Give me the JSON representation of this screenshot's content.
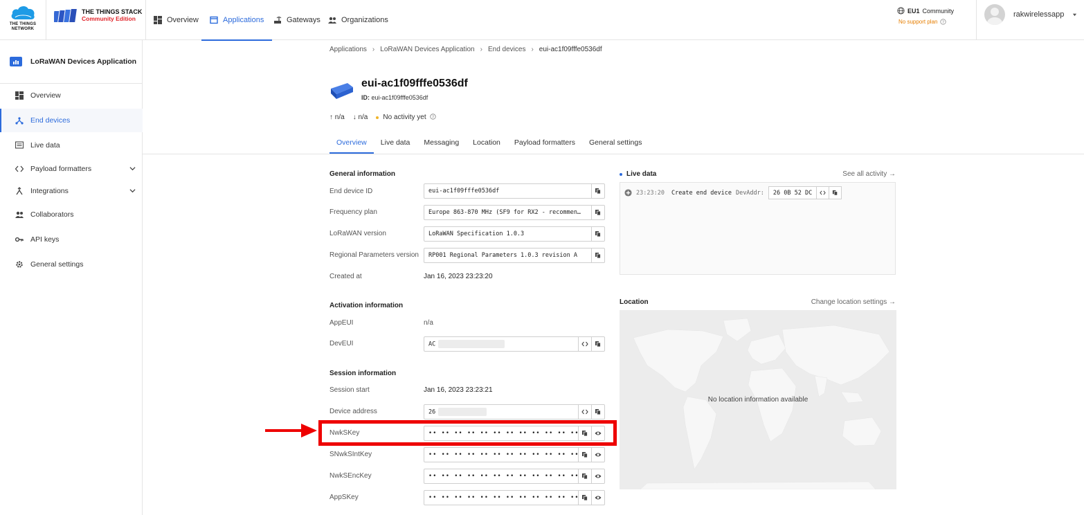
{
  "brand": {
    "ttn_line1": "THE THINGS",
    "ttn_line2": "NETWORK",
    "stack_name": "THE THINGS STACK",
    "stack_edition": "Community Edition"
  },
  "topnav": {
    "items": [
      {
        "label": "Overview"
      },
      {
        "label": "Applications"
      },
      {
        "label": "Gateways"
      },
      {
        "label": "Organizations"
      }
    ],
    "region": "EU1",
    "region_tier": "Community",
    "support": "No support plan",
    "username": "rakwirelessapp"
  },
  "sidebar": {
    "app_title": "LoRaWAN Devices Application",
    "items": [
      {
        "label": "Overview"
      },
      {
        "label": "End devices"
      },
      {
        "label": "Live data"
      },
      {
        "label": "Payload formatters"
      },
      {
        "label": "Integrations"
      },
      {
        "label": "Collaborators"
      },
      {
        "label": "API keys"
      },
      {
        "label": "General settings"
      }
    ]
  },
  "breadcrumb": [
    "Applications",
    "LoRaWAN Devices Application",
    "End devices",
    "eui-ac1f09fffe0536df"
  ],
  "device": {
    "title": "eui-ac1f09fffe0536df",
    "id_label": "ID:",
    "id_value": "eui-ac1f09fffe0536df",
    "uplink": "n/a",
    "downlink": "n/a",
    "activity": "No activity yet"
  },
  "tabs": [
    "Overview",
    "Live data",
    "Messaging",
    "Location",
    "Payload formatters",
    "General settings"
  ],
  "general": {
    "title": "General information",
    "end_device_id_label": "End device ID",
    "end_device_id": "eui-ac1f09fffe0536df",
    "frequency_plan_label": "Frequency plan",
    "frequency_plan": "Europe 863-870 MHz (SF9 for RX2 - recommen…",
    "lorawan_version_label": "LoRaWAN version",
    "lorawan_version": "LoRaWAN Specification 1.0.3",
    "regional_params_label": "Regional Parameters version",
    "regional_params": "RP001 Regional Parameters 1.0.3 revision A",
    "created_at_label": "Created at",
    "created_at": "Jan 16, 2023 23:23:20"
  },
  "activation": {
    "title": "Activation information",
    "appeui_label": "AppEUI",
    "appeui": "n/a",
    "deveui_label": "DevEUI",
    "deveui_prefix": "AC"
  },
  "session": {
    "title": "Session information",
    "start_label": "Session start",
    "start": "Jan 16, 2023 23:23:21",
    "device_address_label": "Device address",
    "device_address_prefix": "26",
    "nwkskey_label": "NwkSKey",
    "snwksintkey_label": "SNwkSIntKey",
    "nwksenckey_label": "NwkSEncKey",
    "appskey_label": "AppSKey",
    "masked": "•• •• •• •• •• •• •• •• •• •• •• •• •• •• •• ••"
  },
  "live": {
    "title": "Live data",
    "link": "See all activity →",
    "event_time": "23:23:20",
    "event_text": "Create end device",
    "event_addr_label": "DevAddr:",
    "event_addr": "26 0B 52 DC"
  },
  "location": {
    "title": "Location",
    "link": "Change location settings →",
    "empty": "No location information available"
  },
  "colors": {
    "accent": "#2c6bdc",
    "highlight": "#ee0000",
    "warning": "#e67e00"
  }
}
